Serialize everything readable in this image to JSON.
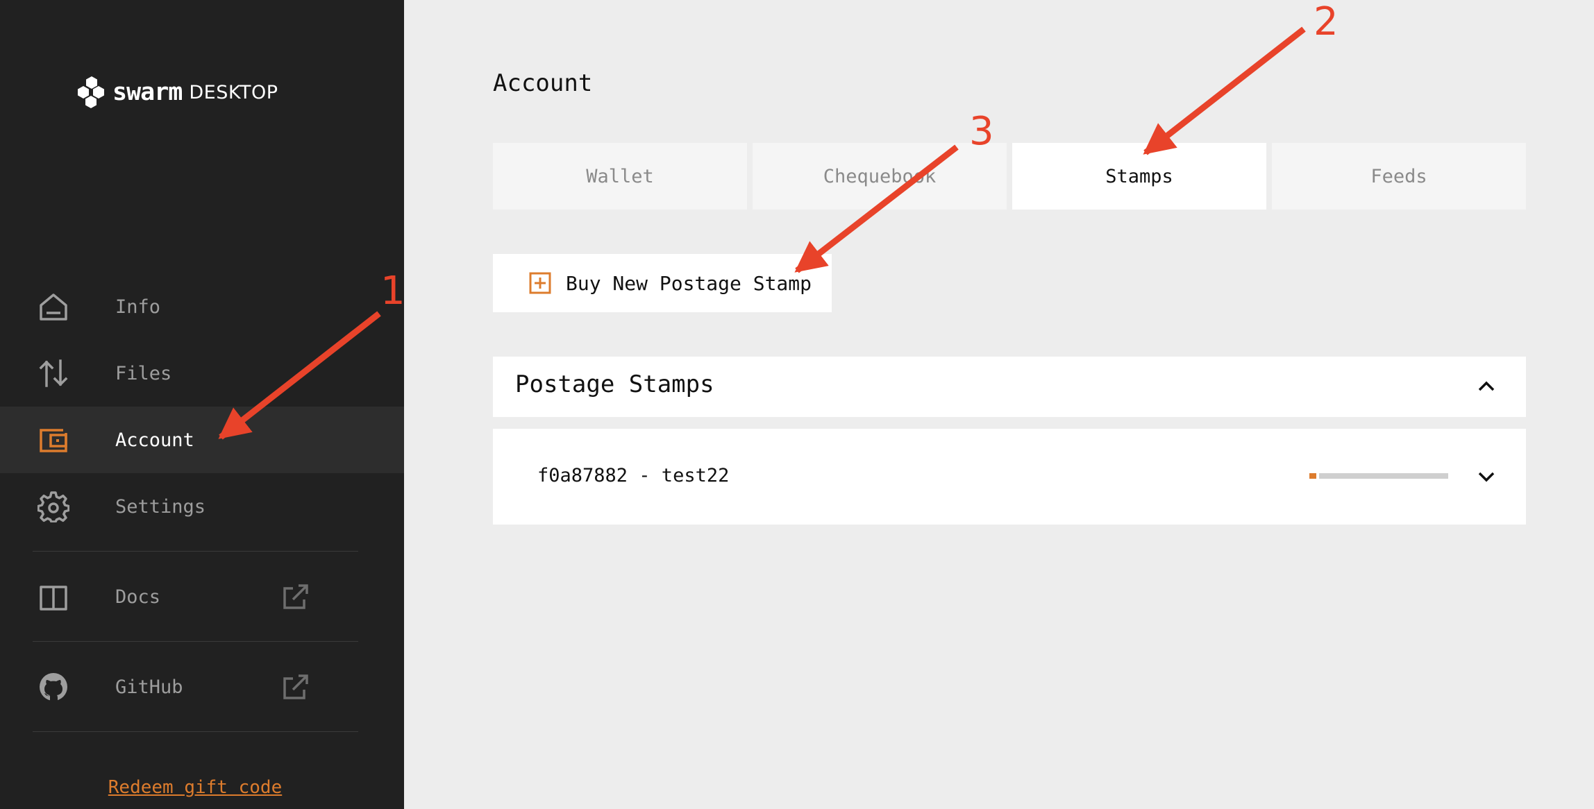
{
  "app": {
    "logo_word": "swarm",
    "logo_sub": "DESKTOP"
  },
  "sidebar": {
    "items": [
      {
        "label": "Info",
        "icon": "home-icon",
        "active": false
      },
      {
        "label": "Files",
        "icon": "transfer-arrows-icon",
        "active": false
      },
      {
        "label": "Account",
        "icon": "wallet-icon",
        "active": true
      },
      {
        "label": "Settings",
        "icon": "gear-icon",
        "active": false
      },
      {
        "label": "Docs",
        "icon": "book-icon",
        "external": true
      },
      {
        "label": "GitHub",
        "icon": "github-icon",
        "external": true
      }
    ],
    "redeem_link": "Redeem gift code"
  },
  "main": {
    "title": "Account",
    "tabs": [
      {
        "label": "Wallet",
        "active": false
      },
      {
        "label": "Chequebook",
        "active": false
      },
      {
        "label": "Stamps",
        "active": true
      },
      {
        "label": "Feeds",
        "active": false
      }
    ],
    "buy_button_label": "Buy New Postage Stamp",
    "stamps_section": {
      "title": "Postage Stamps",
      "expanded": true,
      "stamps": [
        {
          "label": "f0a87882 - test22",
          "usage": 0.05
        }
      ]
    }
  },
  "annotations": [
    {
      "number": "1",
      "target": "Account"
    },
    {
      "number": "2",
      "target": "Stamps"
    },
    {
      "number": "3",
      "target": "Buy New Postage Stamp"
    }
  ],
  "colors": {
    "sidebar_bg": "#212121",
    "accent": "#dd7c2d",
    "annotation": "#e8432a",
    "main_bg": "#ededed"
  }
}
